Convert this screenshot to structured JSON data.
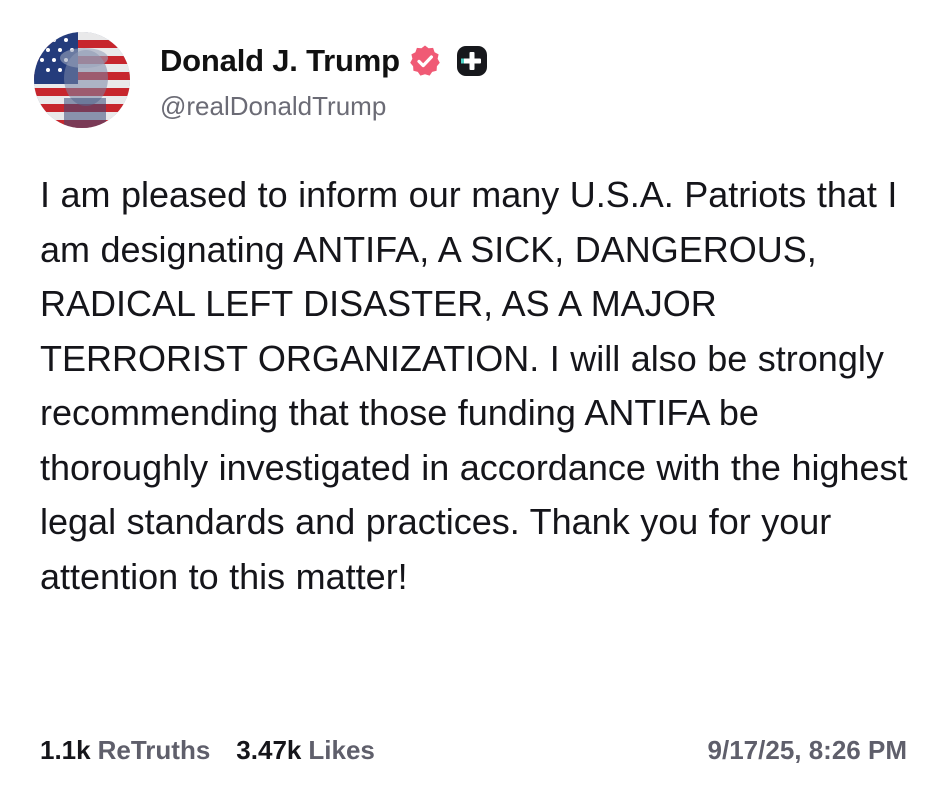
{
  "post": {
    "author": {
      "display_name": "Donald J. Trump",
      "handle": "@realDonaldTrump",
      "avatar_icon": "flag-portrait-avatar",
      "verified_icon": "verified-badge-icon",
      "extra_badge_icon": "plus-badge-icon"
    },
    "body": "I am pleased to inform our many U.S.A. Patriots that I am designating ANTIFA, A SICK, DANGEROUS, RADICAL LEFT DISASTER, AS A MAJOR TERRORIST ORGANIZATION. I will also be strongly recommending that those funding ANTIFA be thoroughly investigated in accordance with the highest legal standards and practices. Thank you for your attention to this matter!",
    "stats": {
      "retruths_count": "1.1k",
      "retruths_label": "ReTruths",
      "likes_count": "3.47k",
      "likes_label": "Likes"
    },
    "timestamp": "9/17/25, 8:26 PM"
  },
  "colors": {
    "verified_badge": "#f05a75",
    "plus_badge": "#17181c",
    "text_primary": "#15151a",
    "text_secondary": "#5f5f6b"
  }
}
